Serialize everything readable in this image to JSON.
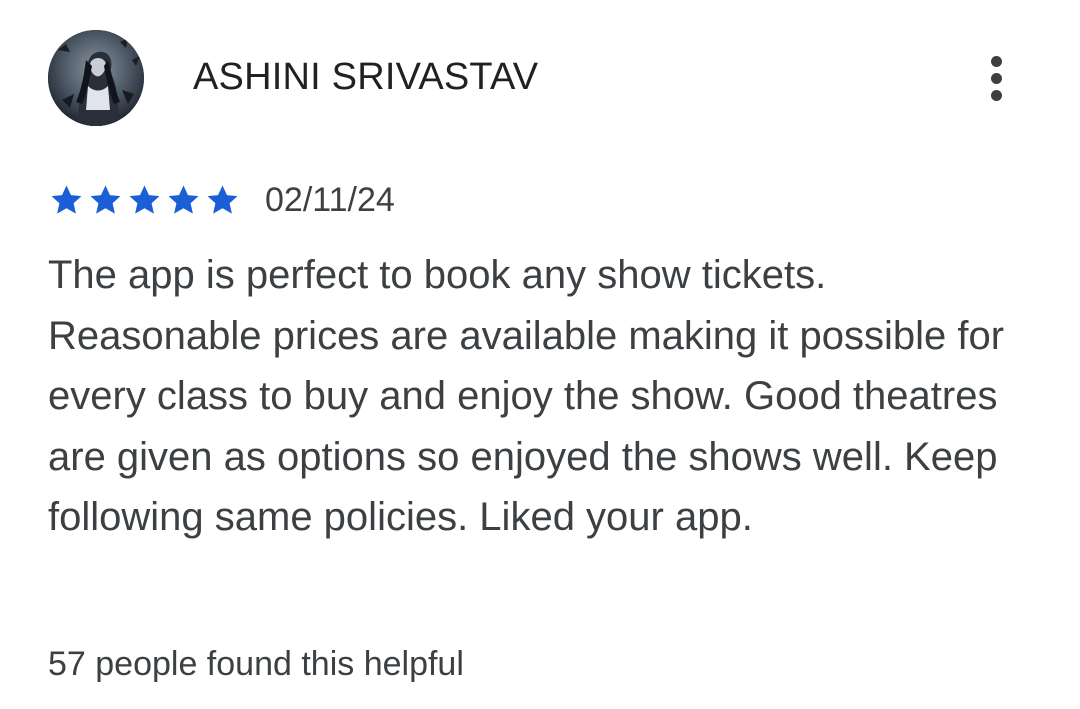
{
  "review": {
    "reviewer_name": "ASHINI SRIVASTAV",
    "avatar_icon": "user-avatar-illustration",
    "more_icon": "more-vertical-icon",
    "rating": 5,
    "rating_max": 5,
    "star_color": "#1a5fd6",
    "date": "02/11/24",
    "text": "The app is perfect to book any show tickets. Reasonable prices are available making it possible for every class to buy and enjoy the show. Good theatres are given as options so enjoyed the shows well. Keep following same policies. Liked your app.",
    "helpful": "57 people found this helpful"
  }
}
